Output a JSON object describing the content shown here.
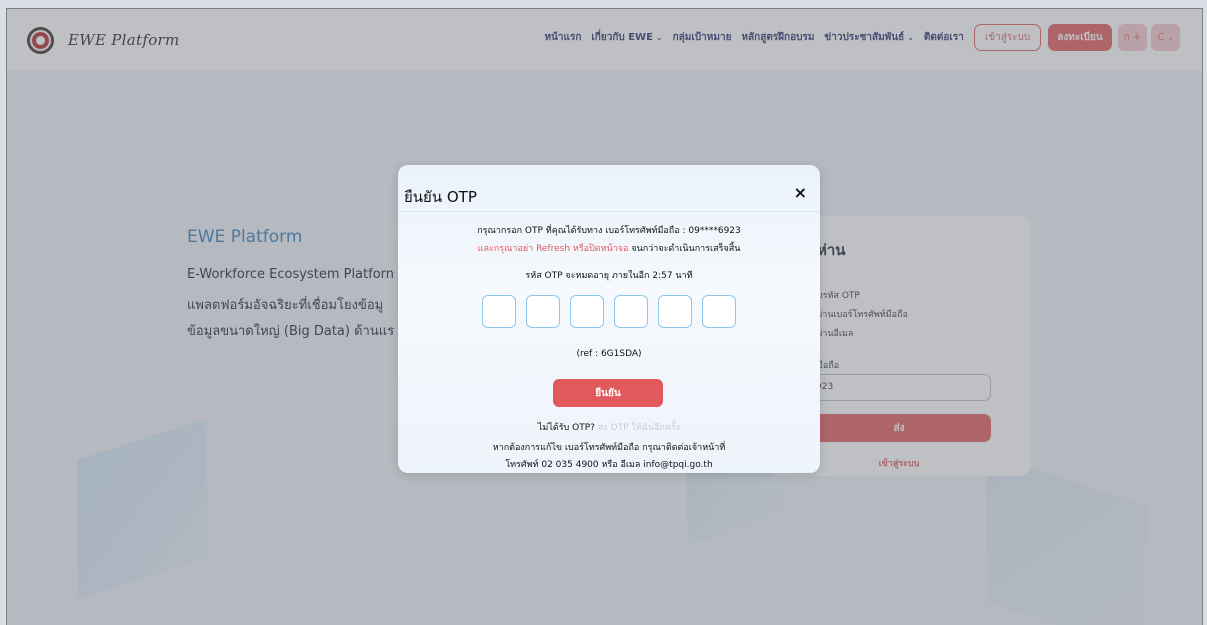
{
  "header": {
    "brand_name": "EWE Platform",
    "nav": [
      {
        "label": "หน้าแรก",
        "has_dropdown": false
      },
      {
        "label": "เกี่ยวกับ EWE",
        "has_dropdown": true
      },
      {
        "label": "กลุ่มเป้าหมาย",
        "has_dropdown": false
      },
      {
        "label": "หลักสูตรฝึกอบรม",
        "has_dropdown": false
      },
      {
        "label": "ข่าวประชาสัมพันธ์",
        "has_dropdown": true
      },
      {
        "label": "ติดต่อเรา",
        "has_dropdown": false
      }
    ],
    "login_label": "เข้าสู่ระบบ",
    "register_label": "ลงทะเบียน",
    "font_chip": "ก +",
    "color_chip": "C"
  },
  "hero": {
    "title": "EWE Platform",
    "line1": "E-Workforce Ecosystem Platforn",
    "line2": "แพลตฟอร์มอัจฉริยะที่เชื่อมโยงข้อมู",
    "line3": "ข้อมูลขนาดใหญ่ (Big Data) ด้านแร"
  },
  "login_card": {
    "title": "ห่าน",
    "otp_label": "บรหัส OTP",
    "radio_phone": "ผ่านเบอร์โทรศัพท์มือถือ",
    "radio_email": "ผ่านอีเมล",
    "phone_label": "มือถือ",
    "phone_value": "923",
    "send_label": "ส่ง",
    "login_link": "เข้าสู่ระบบ"
  },
  "modal": {
    "title": "ยืนยัน OTP",
    "close_glyph": "×",
    "line1": "กรุณากรอก OTP ที่คุณได้รับทาง เบอร์โทรศัพท์มือถือ : 09****6923",
    "line2_warning": "และกรุณาอย่า Refresh หรือปิดหน้าจอ",
    "line2_rest": " จนกว่าจะดำเนินการเสร็จสิ้น",
    "timer": "รหัส OTP จะหมดอายุ ภายในอีก 2:57 นาที",
    "otp_digits": [
      "",
      "",
      "",
      "",
      "",
      ""
    ],
    "ref": "(ref : 6G1SDA)",
    "confirm_label": "ยืนยัน",
    "resend_prefix": "ไม่ได้รับ OTP? ",
    "resend_link": "ส่ง OTP ให้ฉันอีกครั้ง",
    "contact1": "หากต้องการแก้ไข เบอร์โทรศัพท์มือถือ กรุณาติดต่อเจ้าหน้าที่",
    "contact2": "โทรศัพท์ 02 035 4900 หรือ อีเมล info@tpqi.go.th"
  },
  "colors": {
    "accent": "#e2595b",
    "nav_text": "#2a2f6b",
    "hero_title": "#2f7fba",
    "otp_border": "#8fc6ec"
  }
}
